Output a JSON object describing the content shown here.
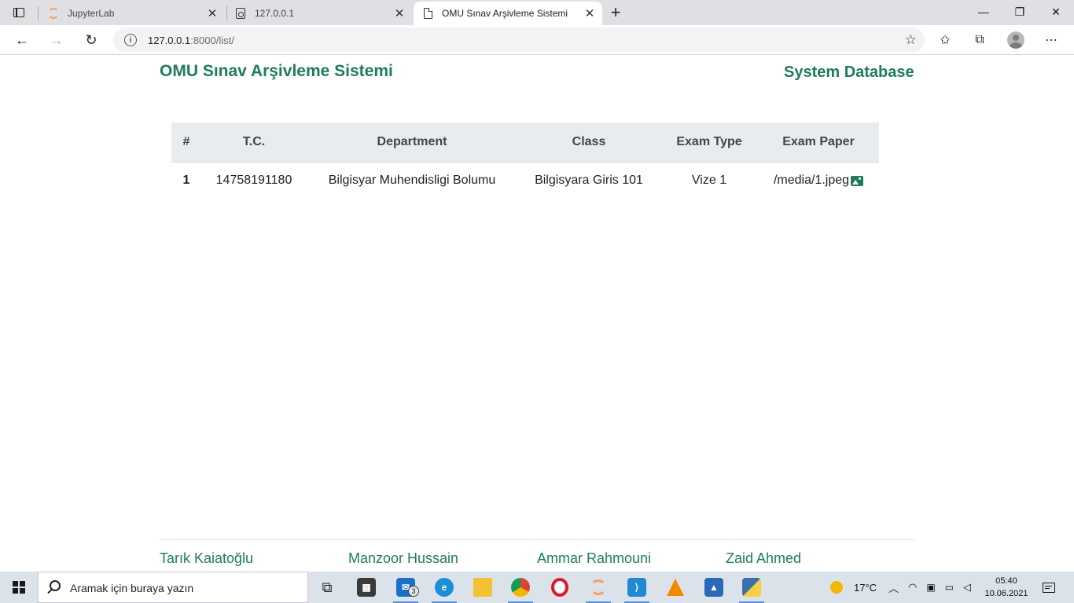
{
  "browser": {
    "tabs": [
      {
        "title": "JupyterLab",
        "icon": "jupyter-icon",
        "active": false
      },
      {
        "title": "127.0.0.1",
        "icon": "pdf-document-icon",
        "active": false
      },
      {
        "title": "OMU Sınav Arşivleme Sistemi",
        "icon": "page-icon",
        "active": true
      }
    ],
    "url_host": "127.0.0.1",
    "url_path": ":8000/list/"
  },
  "page": {
    "brand": "OMU Sınav Arşivleme Sistemi",
    "nav_right": "System Database",
    "table": {
      "headers": [
        "#",
        "T.C.",
        "Department",
        "Class",
        "Exam Type",
        "Exam Paper"
      ],
      "rows": [
        {
          "num": "1",
          "tc": "14758191180",
          "department": "Bilgisyar Muhendisligi Bolumu",
          "class": "Bilgisyara Giris 101",
          "exam_type": "Vize 1",
          "paper": "/media/1.jpeg"
        }
      ]
    },
    "footer_names": [
      "Tarık Kaiatoğlu",
      "Manzoor Hussain",
      "Ammar Rahmouni",
      "Zaid Ahmed"
    ]
  },
  "taskbar": {
    "search_placeholder": "Aramak için buraya yazın",
    "mail_badge": "3",
    "weather": "17°C",
    "time": "05:40",
    "date": "10.06.2021"
  },
  "colors": {
    "brand": "#1e7d58",
    "table_header_bg": "#e9ecef"
  }
}
